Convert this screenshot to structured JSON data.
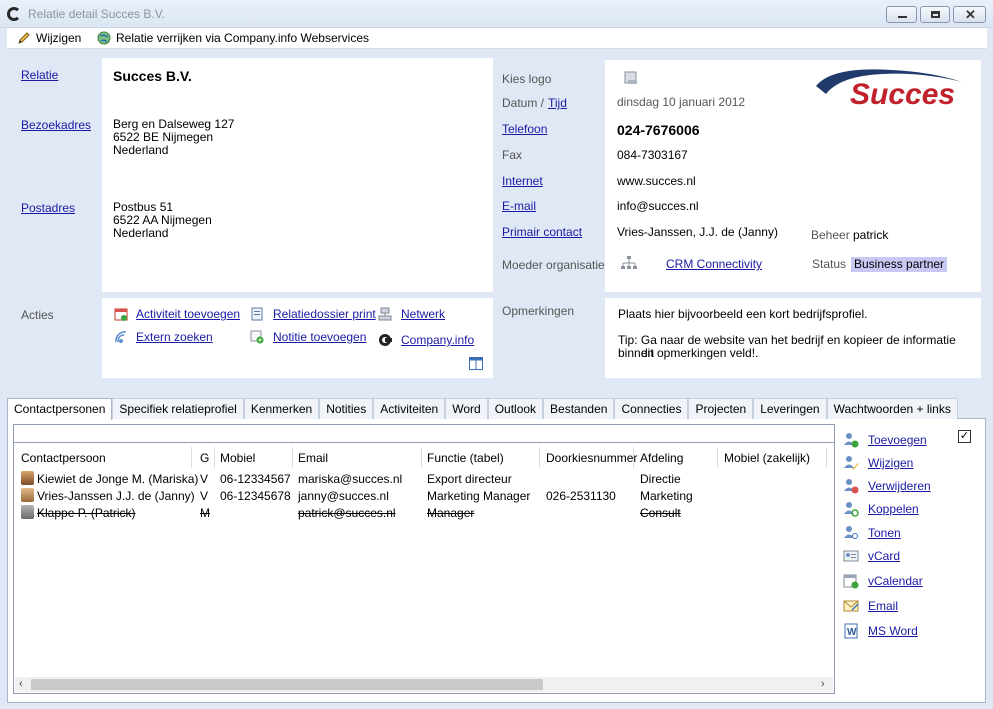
{
  "window": {
    "title": "Relatie detail Succes B.V."
  },
  "toolbar": {
    "edit": "Wijzigen",
    "enrich": "Relatie verrijken via Company.info Webservices"
  },
  "relation": {
    "label_relatie": "Relatie",
    "name": "Succes B.V.",
    "label_bezoekadres": "Bezoekadres",
    "visit_address": [
      "Berg en Dalseweg 127",
      "6522 BE  Nijmegen",
      "Nederland"
    ],
    "label_postadres": "Postadres",
    "postal_address": [
      "Postbus 51",
      "6522 AA  Nijmegen",
      "Nederland"
    ]
  },
  "contact": {
    "label_logo": "Kies logo",
    "label_datum": "Datum  /",
    "label_tijd": "Tijd",
    "date": "dinsdag 10 januari 2012",
    "label_telefoon": "Telefoon",
    "phone": "024-7676006",
    "label_fax": "Fax",
    "fax": "084-7303167",
    "label_internet": "Internet",
    "internet": "www.succes.nl",
    "label_email": "E-mail",
    "email": "info@succes.nl",
    "label_primair": "Primair contact",
    "primary_contact": "Vries-Janssen, J.J. de (Janny)",
    "label_beheer": "Beheer",
    "beheer": "patrick",
    "label_moeder": "Moeder organisatie",
    "parent_org": "CRM Connectivity",
    "label_status": "Status",
    "status": "Business partner",
    "status_color": "#c8c8f5",
    "logo_text": "Succes"
  },
  "actions": {
    "label": "Acties",
    "items": [
      "Activiteit toevoegen",
      "Relatiedossier print",
      "Netwerk",
      "Extern zoeken",
      "Notitie toevoegen",
      "Company.info"
    ]
  },
  "remarks": {
    "label": "Opmerkingen",
    "line1": "Plaats hier bijvoorbeeld een kort bedrijfsprofiel.",
    "line2": "Tip: Ga naar de website van het bedrijf en kopieer de informatie binnen",
    "line3": "dit opmerkingen veld!."
  },
  "tabs": [
    "Contactpersonen",
    "Specifiek relatieprofiel",
    "Kenmerken",
    "Notities",
    "Activiteiten",
    "Word",
    "Outlook",
    "Bestanden",
    "Connecties",
    "Projecten",
    "Leveringen",
    "Wachtwoorden + links"
  ],
  "grid": {
    "columns": [
      "Contactpersoon",
      "G",
      "Mobiel",
      "Email",
      "Functie (tabel)",
      "Doorkiesnummer",
      "Afdeling",
      "Mobiel (zakelijk)"
    ],
    "rows": [
      {
        "name": "Kiewiet de Jonge M. (Mariska)",
        "g": "V",
        "mobile": "06-12334567",
        "email": "mariska@succes.nl",
        "function": "Export directeur",
        "direct": "",
        "dept": "Directie",
        "mobile_work": ""
      },
      {
        "name": "Vries-Janssen J.J. de (Janny)",
        "g": "V",
        "mobile": "06-12345678",
        "email": "janny@succes.nl",
        "function": "Marketing Manager",
        "direct": "026-2531130",
        "dept": "Marketing",
        "mobile_work": ""
      },
      {
        "name": "Klappe P. (Patrick)",
        "g": "M",
        "mobile": "",
        "email": "patrick@succes.nl",
        "function": "Manager",
        "direct": "",
        "dept": "Consult",
        "mobile_work": ""
      }
    ]
  },
  "side_actions": [
    "Toevoegen",
    "Wijzigen",
    "Verwijderen",
    "Koppelen",
    "Tonen",
    "vCard",
    "vCalendar",
    "Email",
    "MS Word"
  ]
}
